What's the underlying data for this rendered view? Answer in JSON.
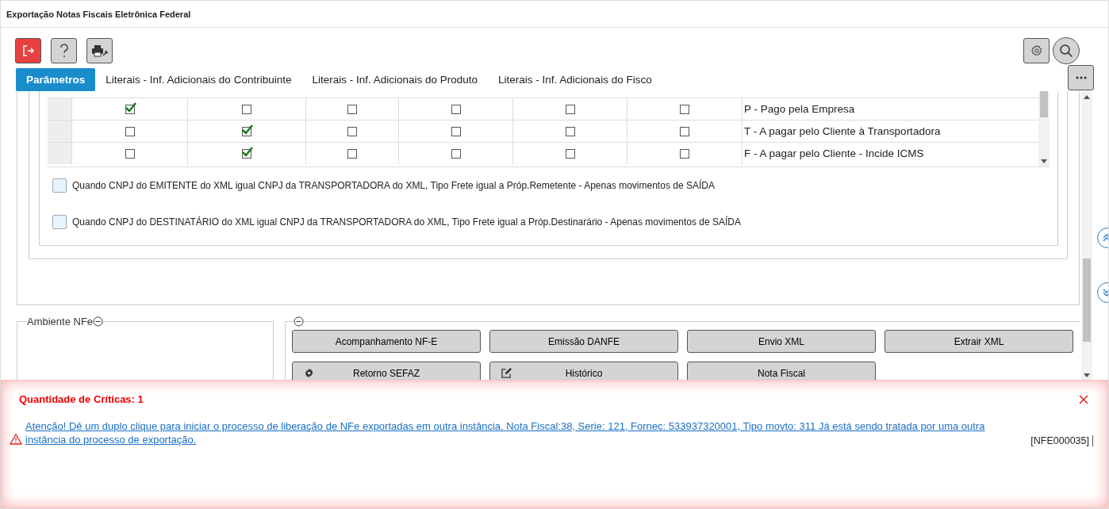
{
  "window": {
    "title": "Exportação Notas Fiscais Eletrônica Federal"
  },
  "tabs": [
    {
      "label": "Parâmetros",
      "selected": true
    },
    {
      "label": "Literais - Inf. Adicionais do Contribuinte",
      "selected": false
    },
    {
      "label": "Literais - Inf. Adicionais do Produto",
      "selected": false
    },
    {
      "label": "Literais - Inf. Adicionais do Fisco",
      "selected": false
    }
  ],
  "table": {
    "rows": [
      {
        "checks": [
          true,
          false,
          false,
          false,
          false,
          false
        ],
        "label": "P - Pago pela Empresa"
      },
      {
        "checks": [
          false,
          true,
          false,
          false,
          false,
          false
        ],
        "label": "T - A pagar pelo Cliente à Transportadora"
      },
      {
        "checks": [
          false,
          true,
          false,
          false,
          false,
          false
        ],
        "label": "F - A pagar pelo Cliente - Incide ICMS"
      }
    ]
  },
  "options": [
    {
      "label": "Quando CNPJ do EMITENTE do XML igual CNPJ da TRANSPORTADORA do XML, Tipo Frete igual a Próp.Remetente - Apenas movimentos de SAÍDA",
      "checked": false
    },
    {
      "label": "Quando CNPJ do DESTINATÁRIO do XML igual CNPJ da TRANSPORTADORA do XML, Tipo Frete igual a Próp.Destinarário - Apenas movimentos de SAÍDA",
      "checked": false
    }
  ],
  "ambiente": {
    "legend": "Ambiente NFe"
  },
  "actions": [
    {
      "label": "Acompanhamento NF-E",
      "kind": "plain"
    },
    {
      "label": "Emissão DANFE",
      "kind": "plain"
    },
    {
      "label": "Envio XML",
      "kind": "plain"
    },
    {
      "label": "Extrair XML",
      "kind": "plain"
    },
    {
      "label": "Retorno SEFAZ",
      "kind": "gear"
    },
    {
      "label": "Histórico",
      "kind": "edit"
    },
    {
      "label": "Nota Fiscal",
      "kind": "plain"
    }
  ],
  "criticas": {
    "title": "Quantidade de Críticas: 1",
    "items": [
      {
        "message": "Atenção! Dê um duplo clique para iniciar o processo de liberação de NFe exportadas em outra instância. Nota Fiscal:38, Serie: 121, Fornec: 533937320001, Tipo movto: 311 Já está sendo tratada por uma outra instância do processo de exportação.",
        "code": "[NFE000035]"
      }
    ]
  }
}
